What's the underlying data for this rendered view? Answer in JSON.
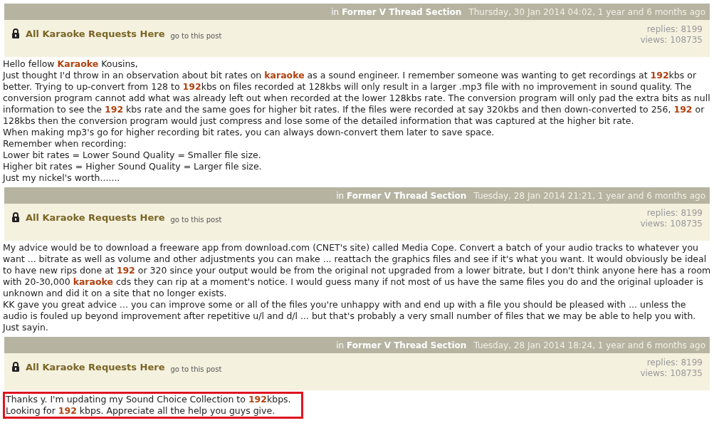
{
  "posts": [
    {
      "section_prefix": "in",
      "section": "Former V Thread Section",
      "date": "Thursday, 30 Jan 2014 04:02, 1 year and 6 months ago",
      "thread_title": "All Karaoke Requests Here",
      "goto_link": "go to this post",
      "replies": "replies: 8199",
      "views": "views: 108735",
      "highlighted": false,
      "lines": [
        "Hello fellow **Karaoke** Kousins,",
        "Just thought I'd throw in an observation about bit rates on **karaoke** as a sound engineer. I remember someone was wanting to get recordings at **192**kbs or better. Trying to up-convert from 128 to **192**kbs on files recorded at 128kbs will only result in a larger .mp3 file with no improvement in sound quality. The conversion program cannot add what was already left out when recorded at the lower 128kbs rate. The conversion program will only pad the extra bits as null information to see the **192** kbs rate and the same goes for higher bit rates. If the files were recorded at say 320kbs and then down-converted to 256, **192** or 128kbs then the conversion program would just compress and lose some of the detailed information that was captured at the higher bit rate.",
        "When making mp3's go for higher recording bit rates, you can always down-convert them later to save space.",
        "Remember when recording:",
        "Lower bit rates = Lower Sound Quality = Smaller file size.",
        "Higher bit rates = Higher Sound Quality = Larger file size.",
        "Just my nickel's worth......."
      ]
    },
    {
      "section_prefix": "in",
      "section": "Former V Thread Section",
      "date": "Tuesday, 28 Jan 2014 21:21, 1 year and 6 months ago",
      "thread_title": "All Karaoke Requests Here",
      "goto_link": "go to this post",
      "replies": "replies: 8199",
      "views": "views: 108735",
      "highlighted": false,
      "lines": [
        "My advice would be to download a freeware app from download.com (CNET's site) called Media Cope. Convert a batch of your audio tracks to whatever you want ... bitrate as well as volume and other adjustments you can make ... reattach the graphics files and see if it's what you want. It would obviously be ideal to have new rips done at **192** or 320 since your output would be from the original not upgraded from a lower bitrate, but I don't think anyone here has a room with 20-30,000 **karaoke** cds they can rip at a moment's notice. I would guess many if not most of us have the same files you do and the original uploader is unknown and did it on a site that no longer exists.",
        "KK gave you great advice ... you can improve some or all of the files you're unhappy with and end up with a file you should be pleased with ... unless the audio is fouled up beyond improvement after repetitive u/l and d/l ... but that's probably a very small number of files that we may be able to help you with.",
        "Just sayin."
      ]
    },
    {
      "section_prefix": "in",
      "section": "Former V Thread Section",
      "date": "Tuesday, 28 Jan 2014 18:24, 1 year and 6 months ago",
      "thread_title": "All Karaoke Requests Here",
      "goto_link": "go to this post",
      "replies": "replies: 8199",
      "views": "views: 108735",
      "highlighted": true,
      "lines": [
        "Thanks y. I'm updating my Sound Choice Collection to **192**kbps.",
        "Looking for **192** kbps. Appreciate all the help you guys give."
      ]
    }
  ]
}
